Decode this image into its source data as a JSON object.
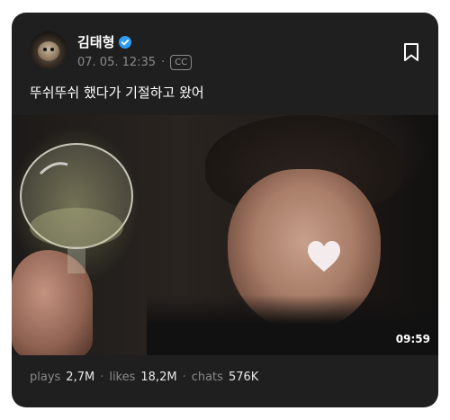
{
  "post": {
    "username": "김태형",
    "verified": true,
    "timestamp": "07. 05. 12:35",
    "separator": "·",
    "cc_label": "CC",
    "caption": "뚜쉬뚜쉬 했다가 기절하고 왔어",
    "bookmark_icon": "bookmark-icon"
  },
  "media": {
    "type": "video-thumbnail",
    "duration": "09:59"
  },
  "stats": {
    "plays_label": "plays",
    "plays_value": "2,7M",
    "likes_label": "likes",
    "likes_value": "18,2M",
    "chats_label": "chats",
    "chats_value": "576K",
    "dot": "·"
  },
  "colors": {
    "card_bg": "#1f1f1f",
    "verified_blue": "#2e9cf3",
    "muted_text": "#8a8a8a",
    "text": "#ffffff"
  }
}
